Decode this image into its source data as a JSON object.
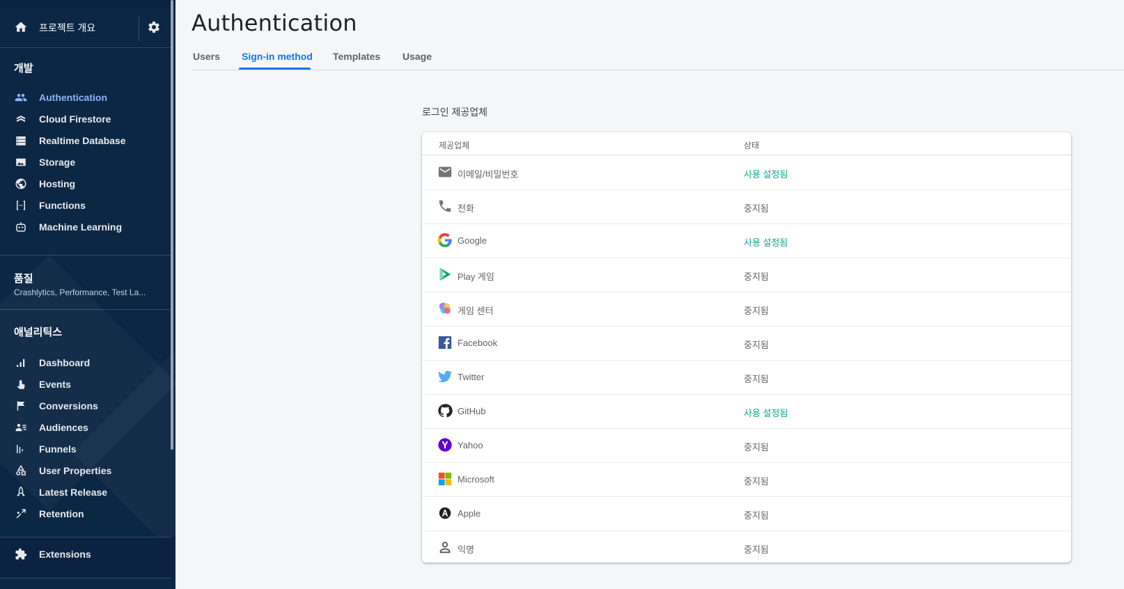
{
  "sidebar": {
    "project_title": "프로젝트 개요",
    "sections": {
      "develop": {
        "title": "개발",
        "items": [
          {
            "label": "Authentication",
            "icon": "people-icon",
            "active": true
          },
          {
            "label": "Cloud Firestore",
            "icon": "firestore-icon"
          },
          {
            "label": "Realtime Database",
            "icon": "database-icon"
          },
          {
            "label": "Storage",
            "icon": "image-icon"
          },
          {
            "label": "Hosting",
            "icon": "globe-icon"
          },
          {
            "label": "Functions",
            "icon": "functions-icon"
          },
          {
            "label": "Machine Learning",
            "icon": "robot-icon"
          }
        ]
      },
      "quality": {
        "title": "품질",
        "subtitle": "Crashlytics, Performance, Test La..."
      },
      "analytics": {
        "title": "애널리틱스",
        "items": [
          {
            "label": "Dashboard",
            "icon": "bar-chart-icon"
          },
          {
            "label": "Events",
            "icon": "touch-icon"
          },
          {
            "label": "Conversions",
            "icon": "flag-icon"
          },
          {
            "label": "Audiences",
            "icon": "audience-icon"
          },
          {
            "label": "Funnels",
            "icon": "funnel-icon"
          },
          {
            "label": "User Properties",
            "icon": "shapes-icon"
          },
          {
            "label": "Latest Release",
            "icon": "rocket-icon"
          },
          {
            "label": "Retention",
            "icon": "retention-icon"
          }
        ]
      }
    },
    "extensions_label": "Extensions"
  },
  "main": {
    "title": "Authentication",
    "tabs": [
      {
        "label": "Users"
      },
      {
        "label": "Sign-in method",
        "active": true
      },
      {
        "label": "Templates"
      },
      {
        "label": "Usage"
      }
    ],
    "providers_title": "로그인 제공업체",
    "table": {
      "headers": {
        "provider": "제공업체",
        "status": "상태"
      },
      "rows": [
        {
          "name": "이메일/비밀번호",
          "status": "사용 설정됨",
          "enabled": true,
          "icon": "email-icon"
        },
        {
          "name": "전화",
          "status": "중지됨",
          "enabled": false,
          "icon": "phone-icon"
        },
        {
          "name": "Google",
          "status": "사용 설정됨",
          "enabled": true,
          "icon": "google-icon"
        },
        {
          "name": "Play 게임",
          "status": "중지됨",
          "enabled": false,
          "icon": "play-games-icon"
        },
        {
          "name": "게임 센터",
          "status": "중지됨",
          "enabled": false,
          "icon": "game-center-icon"
        },
        {
          "name": "Facebook",
          "status": "중지됨",
          "enabled": false,
          "icon": "facebook-icon"
        },
        {
          "name": "Twitter",
          "status": "중지됨",
          "enabled": false,
          "icon": "twitter-icon"
        },
        {
          "name": "GitHub",
          "status": "사용 설정됨",
          "enabled": true,
          "icon": "github-icon"
        },
        {
          "name": "Yahoo",
          "status": "중지됨",
          "enabled": false,
          "icon": "yahoo-icon"
        },
        {
          "name": "Microsoft",
          "status": "중지됨",
          "enabled": false,
          "icon": "microsoft-icon"
        },
        {
          "name": "Apple",
          "status": "중지됨",
          "enabled": false,
          "icon": "apple-icon"
        },
        {
          "name": "익명",
          "status": "중지됨",
          "enabled": false,
          "icon": "anonymous-icon"
        }
      ]
    }
  },
  "colors": {
    "sidebar_bg": "#0c2744",
    "accent": "#1a73e8",
    "active_nav": "#8ab4f8",
    "enabled_status": "#12a392",
    "disabled_status": "#5f6368"
  }
}
